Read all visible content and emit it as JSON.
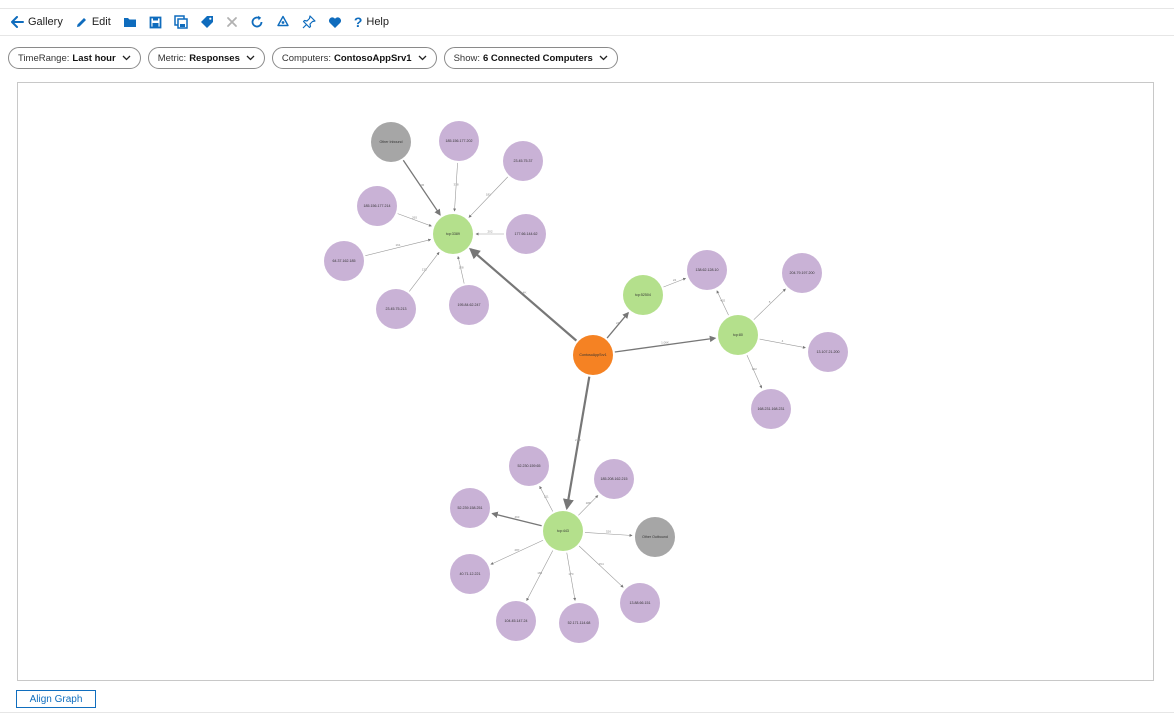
{
  "toolbar": {
    "gallery_label": "Gallery",
    "edit_label": "Edit",
    "help_label": "Help"
  },
  "filters": [
    {
      "key": "TimeRange:",
      "value": "Last hour"
    },
    {
      "key": "Metric:",
      "value": "Responses"
    },
    {
      "key": "Computers:",
      "value": "ContosoAppSrv1"
    },
    {
      "key": "Show:",
      "value": "6 Connected Computers"
    }
  ],
  "align_button_label": "Align Graph",
  "colors": {
    "accent": "#0f6cbd",
    "center_node": "#f58223",
    "port_node": "#b4e08c",
    "ip_node": "#c9b2d6",
    "other_node": "#a6a6a6"
  },
  "graph": {
    "nodes": [
      {
        "id": "center",
        "label": "ContosoAppSrv1",
        "kind": "center"
      },
      {
        "id": "p1",
        "label": "tcp:3389",
        "kind": "port"
      },
      {
        "id": "p2",
        "label": "tcp:52504",
        "kind": "port"
      },
      {
        "id": "p3",
        "label": "tcp:80",
        "kind": "port"
      },
      {
        "id": "p4",
        "label": "tcp:443",
        "kind": "port"
      },
      {
        "id": "oi",
        "label": "Other Inbound",
        "kind": "other"
      },
      {
        "id": "oo",
        "label": "Other Outbound",
        "kind": "other"
      },
      {
        "id": "a1",
        "label": "185.156.177.202",
        "kind": "ip"
      },
      {
        "id": "a2",
        "label": "23.45.75.37",
        "kind": "ip"
      },
      {
        "id": "a3",
        "label": "185.156.177.214",
        "kind": "ip"
      },
      {
        "id": "a4",
        "label": "177.66.144.62",
        "kind": "ip"
      },
      {
        "id": "a5",
        "label": "64.37.162.185",
        "kind": "ip"
      },
      {
        "id": "a6",
        "label": "23.45.75.213",
        "kind": "ip"
      },
      {
        "id": "a7",
        "label": "195.84.62.247",
        "kind": "ip"
      },
      {
        "id": "b1",
        "label": "138.62.128.10",
        "kind": "ip"
      },
      {
        "id": "b2",
        "label": "204.79.197.200",
        "kind": "ip"
      },
      {
        "id": "b3",
        "label": "13.107.21.200",
        "kind": "ip"
      },
      {
        "id": "b4",
        "label": "168.231.168.231",
        "kind": "ip"
      },
      {
        "id": "c1",
        "label": "52.230.159.65",
        "kind": "ip"
      },
      {
        "id": "c2",
        "label": "185.208.162.215",
        "kind": "ip"
      },
      {
        "id": "c3",
        "label": "52.239.158.251",
        "kind": "ip"
      },
      {
        "id": "c4",
        "label": "40.71.12.221",
        "kind": "ip"
      },
      {
        "id": "c5",
        "label": "104.45.147.24",
        "kind": "ip"
      },
      {
        "id": "c6",
        "label": "52.171.114.68",
        "kind": "ip"
      },
      {
        "id": "c7",
        "label": "13.88.66.151",
        "kind": "ip"
      }
    ],
    "edges": [
      {
        "from": "center",
        "to": "p1",
        "label": "1.4K"
      },
      {
        "from": "center",
        "to": "p2",
        "label": "24"
      },
      {
        "from": "center",
        "to": "p3",
        "label": "1.06K"
      },
      {
        "from": "center",
        "to": "p4",
        "label": "2.4K"
      },
      {
        "from": "oi",
        "to": "p1",
        "label": "436"
      },
      {
        "from": "a1",
        "to": "p1",
        "label": "338"
      },
      {
        "from": "a2",
        "to": "p1",
        "label": "181"
      },
      {
        "from": "a3",
        "to": "p1",
        "label": "265"
      },
      {
        "from": "a4",
        "to": "p1",
        "label": "202"
      },
      {
        "from": "a5",
        "to": "p1",
        "label": "161"
      },
      {
        "from": "a6",
        "to": "p1",
        "label": "133"
      },
      {
        "from": "a7",
        "to": "p1",
        "label": "108"
      },
      {
        "from": "p2",
        "to": "b1",
        "label": "24"
      },
      {
        "from": "p3",
        "to": "b1",
        "label": "402"
      },
      {
        "from": "p3",
        "to": "b2",
        "label": "5"
      },
      {
        "from": "p3",
        "to": "b3",
        "label": "4"
      },
      {
        "from": "p3",
        "to": "b4",
        "label": "302"
      },
      {
        "from": "p4",
        "to": "c1",
        "label": "211"
      },
      {
        "from": "p4",
        "to": "c2",
        "label": "186"
      },
      {
        "from": "p4",
        "to": "c3",
        "label": "463"
      },
      {
        "from": "p4",
        "to": "c4",
        "label": "287"
      },
      {
        "from": "p4",
        "to": "c5",
        "label": "165"
      },
      {
        "from": "p4",
        "to": "c6",
        "label": "170"
      },
      {
        "from": "p4",
        "to": "c7",
        "label": "154"
      },
      {
        "from": "p4",
        "to": "oo",
        "label": "526"
      }
    ]
  }
}
